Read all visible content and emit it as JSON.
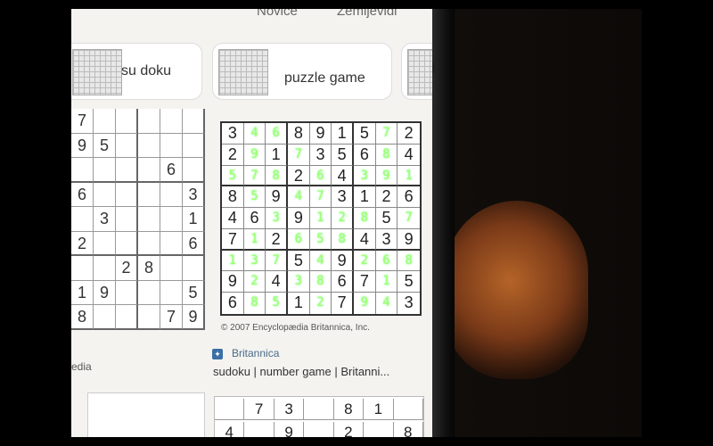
{
  "nav": {
    "item1": "Novice",
    "item2": "Zemljevidi"
  },
  "chips": [
    {
      "label": "su doku"
    },
    {
      "label": "puzzle game"
    }
  ],
  "left_grid_values": [
    [
      "7",
      "",
      "",
      "",
      "",
      ""
    ],
    [
      "9",
      "5",
      "",
      "",
      "",
      ""
    ],
    [
      "",
      "",
      "",
      "",
      "6",
      ""
    ],
    [
      "6",
      "",
      "",
      "",
      "",
      "3"
    ],
    [
      "",
      "3",
      "",
      "",
      "",
      "1"
    ],
    [
      "2",
      "",
      "",
      "",
      "",
      "6"
    ],
    [
      "",
      "",
      "2",
      "8",
      "",
      ""
    ],
    [
      "1",
      "9",
      "",
      "",
      "",
      "5"
    ],
    [
      "8",
      "",
      "",
      "",
      "7",
      "9"
    ]
  ],
  "sudoku": {
    "grid": [
      [
        "3",
        "4",
        "6",
        "8",
        "9",
        "1",
        "5",
        "7",
        "2"
      ],
      [
        "2",
        "9",
        "1",
        "7",
        "3",
        "5",
        "6",
        "8",
        "4"
      ],
      [
        "5",
        "7",
        "8",
        "2",
        "6",
        "4",
        "3",
        "9",
        "1"
      ],
      [
        "8",
        "5",
        "9",
        "4",
        "7",
        "3",
        "1",
        "2",
        "6"
      ],
      [
        "4",
        "6",
        "3",
        "9",
        "1",
        "2",
        "8",
        "5",
        "7"
      ],
      [
        "7",
        "1",
        "2",
        "6",
        "5",
        "8",
        "4",
        "3",
        "9"
      ],
      [
        "1",
        "3",
        "7",
        "5",
        "4",
        "9",
        "2",
        "6",
        "8"
      ],
      [
        "9",
        "2",
        "4",
        "3",
        "8",
        "6",
        "7",
        "1",
        "5"
      ],
      [
        "6",
        "8",
        "5",
        "1",
        "2",
        "7",
        "9",
        "4",
        "3"
      ]
    ],
    "filled": [
      [
        0,
        1,
        1,
        0,
        0,
        0,
        0,
        1,
        0
      ],
      [
        0,
        1,
        0,
        1,
        0,
        0,
        0,
        1,
        0
      ],
      [
        1,
        1,
        1,
        0,
        1,
        0,
        1,
        1,
        1
      ],
      [
        0,
        1,
        0,
        1,
        1,
        0,
        0,
        0,
        0
      ],
      [
        0,
        0,
        1,
        0,
        1,
        1,
        1,
        0,
        1
      ],
      [
        0,
        1,
        0,
        1,
        1,
        1,
        0,
        0,
        0
      ],
      [
        1,
        1,
        1,
        0,
        1,
        0,
        1,
        1,
        1
      ],
      [
        0,
        1,
        0,
        1,
        1,
        0,
        0,
        1,
        0
      ],
      [
        0,
        1,
        1,
        0,
        1,
        0,
        1,
        1,
        0
      ]
    ]
  },
  "copyright": "© 2007 Encyclopædia Britannica, Inc.",
  "result": {
    "source": "Britannica",
    "title": "sudoku | number game | Britanni..."
  },
  "left_result_fragment": "edia",
  "bottom_grid_top": [
    "",
    "7",
    "3",
    "",
    "8",
    "1",
    ""
  ],
  "bottom_grid_bottom": [
    "4",
    "",
    "9",
    "",
    "2",
    "",
    "8"
  ]
}
